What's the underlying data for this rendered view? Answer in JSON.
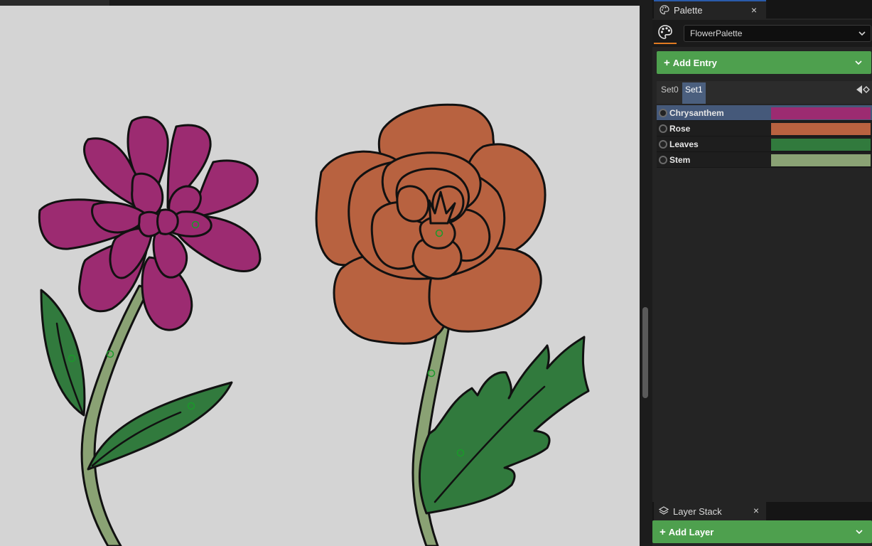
{
  "palette_panel": {
    "tab_title": "Palette",
    "close_glyph": "×",
    "palette_name": "FlowerPalette",
    "add_entry_label": "Add Entry",
    "plus_glyph": "+",
    "sets": [
      {
        "label": "Set0",
        "selected": false
      },
      {
        "label": "Set1",
        "selected": true
      }
    ],
    "entries": [
      {
        "name": "Chrysanthem",
        "color": "#9c2b71",
        "selected": true
      },
      {
        "name": "Rose",
        "color": "#b86240",
        "selected": false
      },
      {
        "name": "Leaves",
        "color": "#317a3d",
        "selected": false
      },
      {
        "name": "Stem",
        "color": "#8aa274",
        "selected": false
      }
    ]
  },
  "layer_panel": {
    "tab_title": "Layer Stack",
    "close_glyph": "×",
    "add_layer_label": "Add Layer",
    "plus_glyph": "+"
  },
  "colors": {
    "canvas_bg": "#d4d4d4",
    "accent_green": "#4ea04e",
    "selection_blue": "#45597a",
    "outline": "#111111",
    "marker_green": "#1a9a2a"
  },
  "icons": {
    "palette_tab": "palette-icon",
    "layer_tab": "layers-icon",
    "dropdown": "chevron-down-icon",
    "nav": "nav-arrows-icon"
  }
}
